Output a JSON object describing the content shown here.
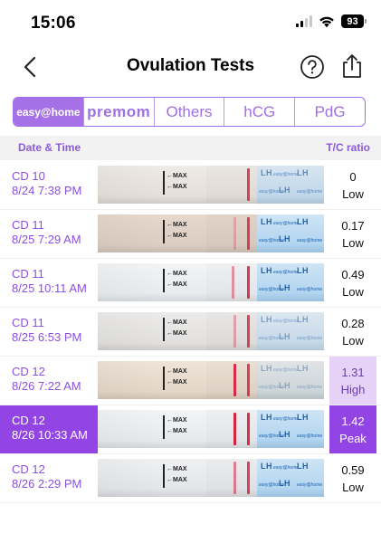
{
  "status_bar": {
    "time": "15:06",
    "battery": "93",
    "icons": [
      "signal-icon",
      "wifi-icon",
      "battery-icon"
    ]
  },
  "nav": {
    "title": "Ovulation Tests",
    "back_icon": "chevron-left-icon",
    "help_icon": "question-circle-icon",
    "share_icon": "share-icon"
  },
  "tabs": [
    {
      "label": "easy@home",
      "active": true
    },
    {
      "label": "premom",
      "active": false
    },
    {
      "label": "Others",
      "active": false
    },
    {
      "label": "hCG",
      "active": false
    },
    {
      "label": "PdG",
      "active": false
    }
  ],
  "table_header": {
    "date": "Date & Time",
    "ratio": "T/C ratio"
  },
  "strip_labels": {
    "max": "←MAX",
    "lh": "LH",
    "brand": "easy@home"
  },
  "rows": [
    {
      "cd": "CD 10",
      "datetime": "8/24 7:38 PM",
      "ratio": "0",
      "level": "Low",
      "selected": false
    },
    {
      "cd": "CD 11",
      "datetime": "8/25 7:29 AM",
      "ratio": "0.17",
      "level": "Low",
      "selected": false
    },
    {
      "cd": "CD 11",
      "datetime": "8/25 10:11 AM",
      "ratio": "0.49",
      "level": "Low",
      "selected": false
    },
    {
      "cd": "CD 11",
      "datetime": "8/25 6:53 PM",
      "ratio": "0.28",
      "level": "Low",
      "selected": false
    },
    {
      "cd": "CD 12",
      "datetime": "8/26 7:22 AM",
      "ratio": "1.31",
      "level": "High",
      "selected": false
    },
    {
      "cd": "CD 12",
      "datetime": "8/26 10:33 AM",
      "ratio": "1.42",
      "level": "Peak",
      "selected": true
    },
    {
      "cd": "CD 12",
      "datetime": "8/26 2:29 PM",
      "ratio": "0.59",
      "level": "Low",
      "selected": false
    }
  ],
  "colors": {
    "accent": "#9344e4",
    "tab_active": "#a671e7",
    "tab_text": "#9f6fe5",
    "high_bg": "#e6d2f7",
    "strip_line": "#d9233f",
    "lh_blue": "#a9d0ef"
  }
}
